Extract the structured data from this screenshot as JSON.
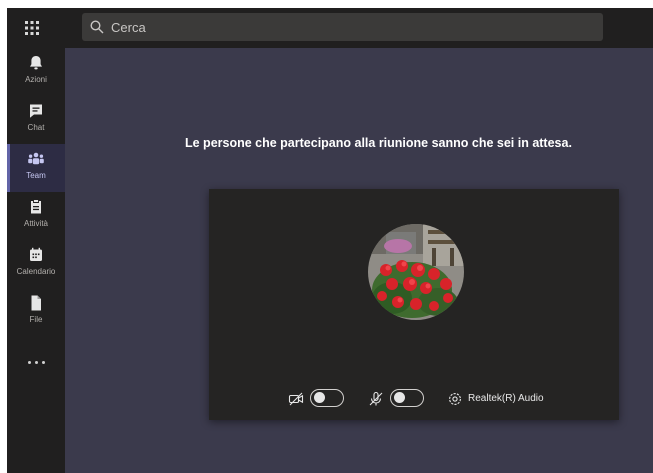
{
  "search": {
    "placeholder": "Cerca"
  },
  "rail": {
    "items": [
      {
        "label": "Azioni",
        "icon": "bell-icon"
      },
      {
        "label": "Chat",
        "icon": "chat-icon"
      },
      {
        "label": "Team",
        "icon": "team-icon",
        "active": true
      },
      {
        "label": "Attività",
        "icon": "assignments-icon"
      },
      {
        "label": "Calendario",
        "icon": "calendar-icon"
      },
      {
        "label": "File",
        "icon": "file-icon"
      }
    ],
    "more_icon": "more-icon"
  },
  "main": {
    "waiting_message": "Le persone che partecipano alla riunione sanno che sei in attesa."
  },
  "controls": {
    "camera": {
      "icon": "camera-off-icon",
      "enabled": false
    },
    "microphone": {
      "icon": "mic-off-icon",
      "enabled": false
    },
    "audio_device": {
      "icon": "settings-icon",
      "label": "Realtek(R) Audio"
    }
  },
  "colors": {
    "rail_bg": "#201f1f",
    "main_bg": "#3b3a4c",
    "preview_bg": "#252423",
    "accent": "#6264a7"
  }
}
